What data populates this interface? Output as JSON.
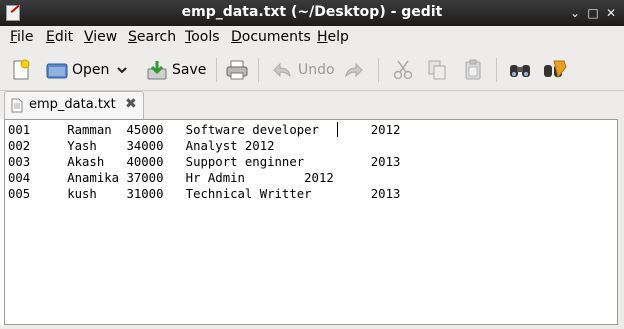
{
  "window": {
    "title": "emp_data.txt (~/Desktop) - gedit"
  },
  "menu": {
    "items": [
      {
        "u": "F",
        "rest": "ile"
      },
      {
        "u": "E",
        "rest": "dit"
      },
      {
        "u": "V",
        "rest": "iew"
      },
      {
        "u": "S",
        "rest": "earch"
      },
      {
        "u": "T",
        "rest": "ools"
      },
      {
        "u": "D",
        "rest": "ocuments"
      },
      {
        "u": "H",
        "rest": "elp"
      }
    ]
  },
  "toolbar": {
    "open_label": "Open",
    "save_label": "Save",
    "undo_label": "Undo"
  },
  "tab": {
    "label": "emp_data.txt"
  },
  "editor": {
    "lines": [
      "001     Ramman  45000   Software developer       2012",
      "002     Yash    34000   Analyst 2012",
      "003     Akash   40000   Support enginner         2013",
      "004     Anamika 37000   Hr Admin        2012",
      "005     kush    31000   Technical Writter        2013"
    ]
  },
  "colors": {
    "titlebar": "#1c1c1c",
    "chrome": "#edeceb",
    "editor_bg": "#ffffff"
  }
}
